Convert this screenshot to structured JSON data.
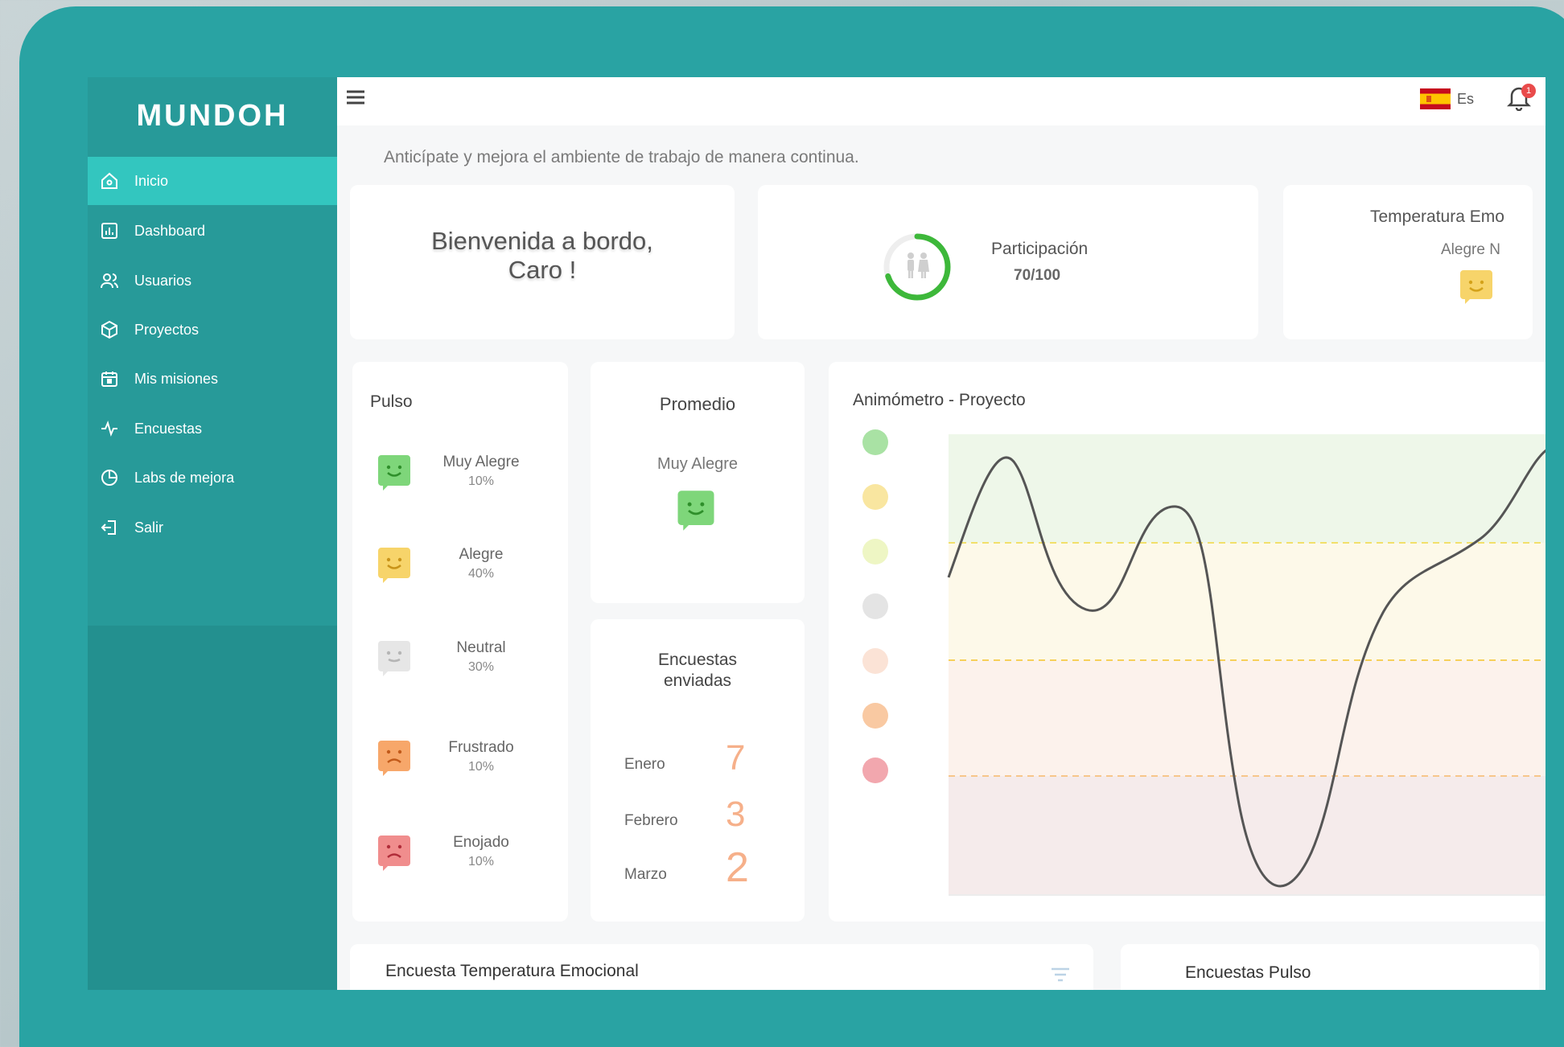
{
  "app": {
    "logo": "MUNDOH",
    "subtitle": "Anticípate y mejora el ambiente de trabajo de manera continua."
  },
  "sidebar": {
    "items": [
      {
        "label": "Inicio",
        "icon": "home-icon",
        "active": true
      },
      {
        "label": "Dashboard",
        "icon": "chart-icon"
      },
      {
        "label": "Usuarios",
        "icon": "users-icon"
      },
      {
        "label": "Proyectos",
        "icon": "box-icon"
      },
      {
        "label": "Mis misiones",
        "icon": "calendar-icon"
      },
      {
        "label": "Encuestas",
        "icon": "pulse-icon"
      },
      {
        "label": "Labs de mejora",
        "icon": "pie-icon"
      },
      {
        "label": "Salir",
        "icon": "logout-icon"
      }
    ]
  },
  "topbar": {
    "language": "Es",
    "notifications": "1"
  },
  "welcome": {
    "line1": "Bienvenida a bordo,",
    "line2": "Caro !"
  },
  "participation": {
    "label": "Participación",
    "value": "70/100",
    "progress": 0.7
  },
  "temperature": {
    "title": "Temperatura Emo",
    "mood": "Alegre N"
  },
  "pulse": {
    "title": "Pulso",
    "moods": [
      {
        "name": "Muy Alegre",
        "pct": "10%",
        "color": "#7ed67a"
      },
      {
        "name": "Alegre",
        "pct": "40%",
        "color": "#f7d46a"
      },
      {
        "name": "Neutral",
        "pct": "30%",
        "color": "#e2e2e2"
      },
      {
        "name": "Frustrado",
        "pct": "10%",
        "color": "#f7a76a"
      },
      {
        "name": "Enojado",
        "pct": "10%",
        "color": "#f08d8d"
      }
    ]
  },
  "average": {
    "title": "Promedio",
    "mood": "Muy Alegre"
  },
  "sent": {
    "title1": "Encuestas",
    "title2": "enviadas",
    "rows": [
      {
        "month": "Enero",
        "value": "7"
      },
      {
        "month": "Febrero",
        "value": "3"
      },
      {
        "month": "Marzo",
        "value": "2"
      }
    ]
  },
  "animometro": {
    "title": "Animómetro - Proyecto",
    "legend_colors": [
      "#a9e2a4",
      "#f9e6a0",
      "#eef6c4",
      "#e4e4e4",
      "#fbe3d6",
      "#f9c9a2",
      "#f2a7ae"
    ]
  },
  "bottom": {
    "card1_title": "Encuesta Temperatura Emocional",
    "card2_title": "Encuestas Pulso"
  },
  "colors": {
    "device": "#29a3a3",
    "sidebar": "#279a99",
    "active": "#33c6bf"
  }
}
